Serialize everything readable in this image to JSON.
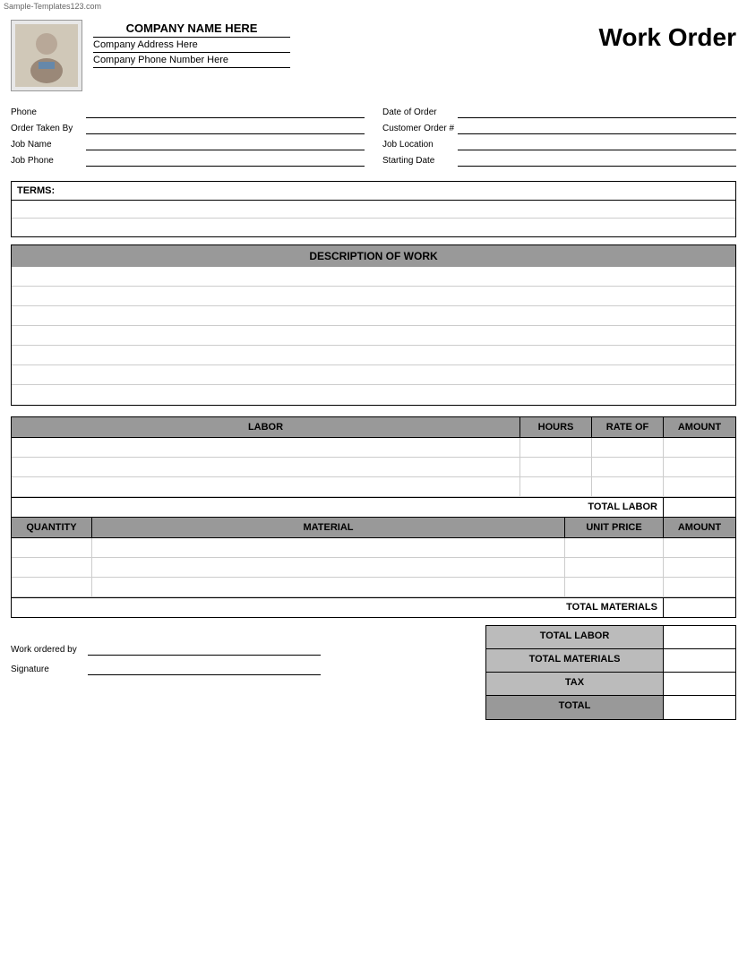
{
  "watermark": "Sample-Templates123.com",
  "header": {
    "company_name": "COMPANY NAME HERE",
    "company_address": "Company Address Here",
    "company_phone": "Company Phone Number Here",
    "title": "Work Order"
  },
  "form": {
    "phone_label": "Phone",
    "order_taken_by_label": "Order Taken By",
    "job_name_label": "Job Name",
    "job_phone_label": "Job Phone",
    "date_of_order_label": "Date of Order",
    "customer_order_label": "Customer Order #",
    "job_location_label": "Job Location",
    "starting_date_label": "Starting Date"
  },
  "terms": {
    "label": "TERMS:"
  },
  "description": {
    "header": "DESCRIPTION OF WORK",
    "rows": 7
  },
  "labor": {
    "col1": "LABOR",
    "col2": "HOURS",
    "col3": "RATE OF",
    "col4": "AMOUNT",
    "total_label": "TOTAL LABOR",
    "rows": 3
  },
  "material": {
    "col1": "QUANTITY",
    "col2": "MATERIAL",
    "col3": "UNIT PRICE",
    "col4": "AMOUNT",
    "total_label": "TOTAL MATERIALS",
    "rows": 3
  },
  "summary": {
    "work_ordered_by_label": "Work ordered by",
    "signature_label": "Signature",
    "total_labor_label": "TOTAL LABOR",
    "total_materials_label": "TOTAL MATERIALS",
    "tax_label": "TAX",
    "total_label": "TOTAL"
  }
}
